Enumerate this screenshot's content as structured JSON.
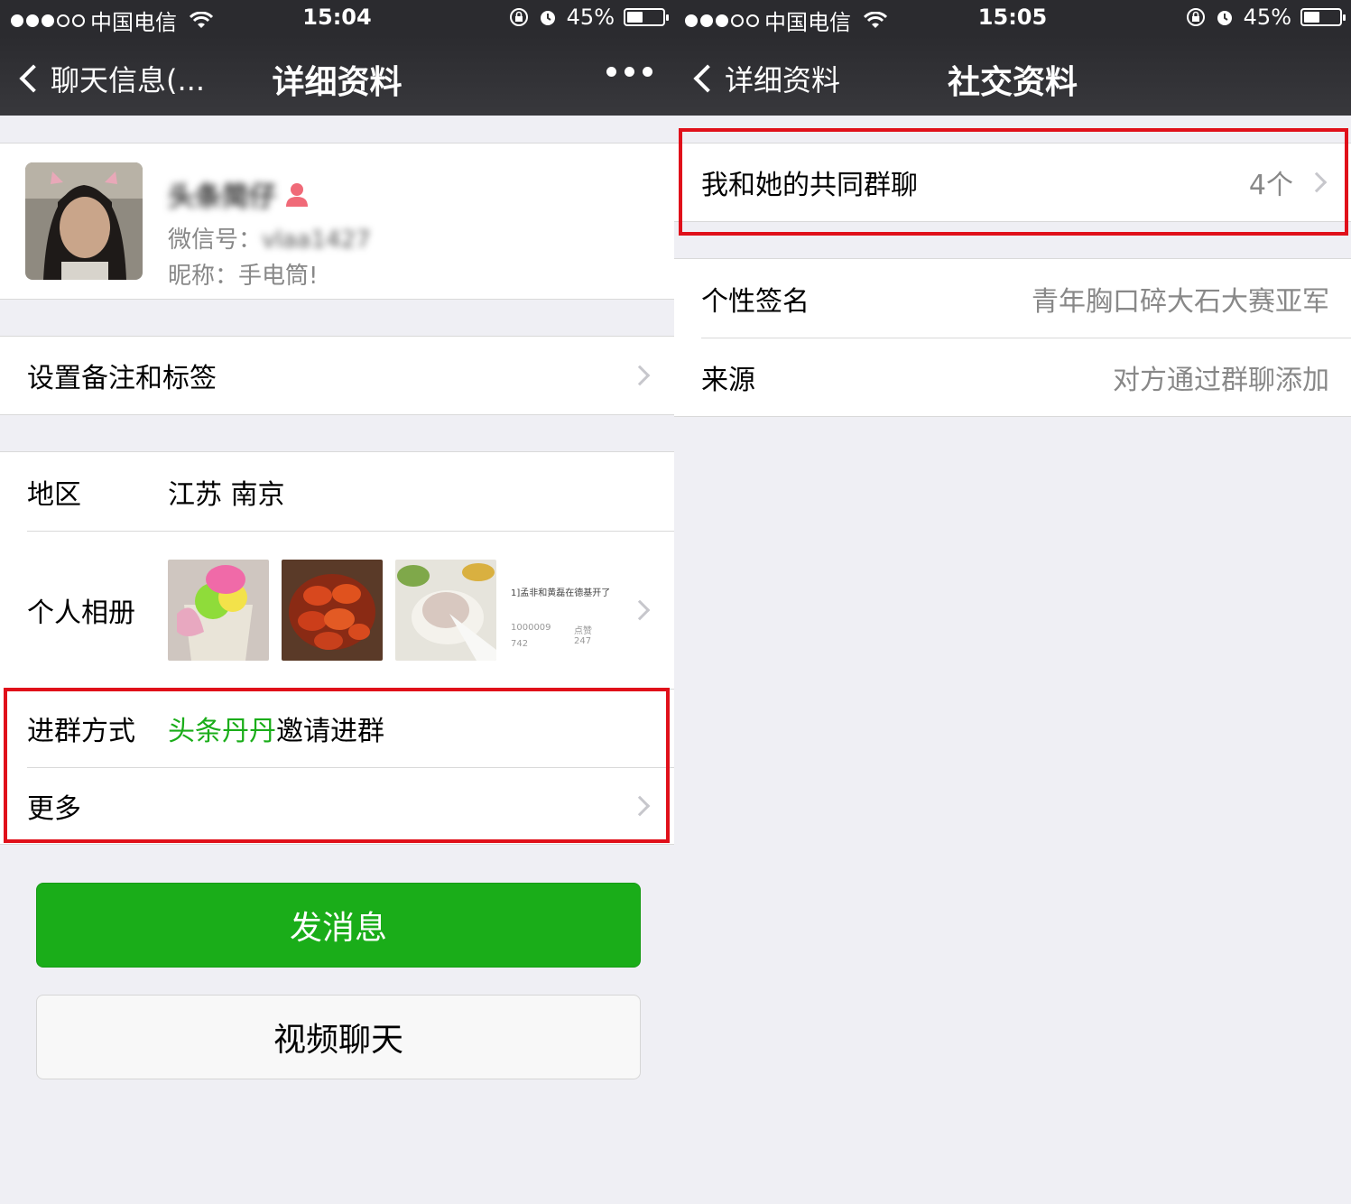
{
  "colors": {
    "accent_green": "#1aad19",
    "highlight_red": "#e0101a",
    "nav_bg": "#333337",
    "page_bg": "#efeff4"
  },
  "left": {
    "status": {
      "carrier": "中国电信",
      "time": "15:04",
      "battery": "45%"
    },
    "nav": {
      "back_label": "聊天信息(...",
      "title": "详细资料",
      "more_icon": "more-dots-icon"
    },
    "profile": {
      "name": "头条简仔",
      "wechat_id_label": "微信号：",
      "wechat_id": "vlaa1427",
      "nickname_label": "昵称：",
      "nickname": "手电筒!"
    },
    "remark_label": "设置备注和标签",
    "region": {
      "label": "地区",
      "value": "江苏 南京"
    },
    "album": {
      "label": "个人相册",
      "preview_text": {
        "headline": "1]孟非和黄磊在德基开了",
        "meta_left": "1000009",
        "meta_right": "点赞 247",
        "meta_bottom": "742"
      }
    },
    "join_method": {
      "label": "进群方式",
      "inviter": "头条丹丹",
      "suffix": "邀请进群"
    },
    "more_label": "更多",
    "send_message_button": "发消息",
    "video_chat_button": "视频聊天"
  },
  "right": {
    "status": {
      "carrier": "中国电信",
      "time": "15:05",
      "battery": "45%"
    },
    "nav": {
      "back_label": "详细资料",
      "title": "社交资料"
    },
    "common_groups": {
      "label": "我和她的共同群聊",
      "count": "4个"
    },
    "signature": {
      "label": "个性签名",
      "value": "青年胸口碎大石大赛亚军"
    },
    "source": {
      "label": "来源",
      "value": "对方通过群聊添加"
    }
  }
}
